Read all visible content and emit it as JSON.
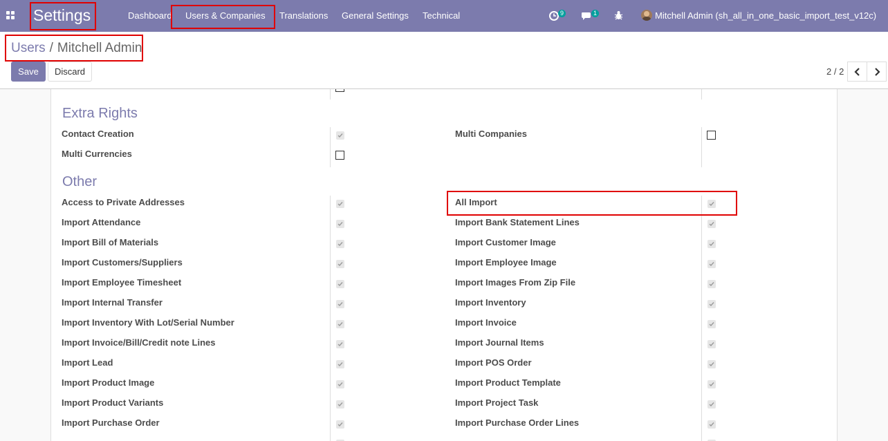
{
  "navbar": {
    "brand": "Settings",
    "menu": [
      {
        "label": "Dashboard"
      },
      {
        "label": "Users & Companies"
      },
      {
        "label": "Translations"
      },
      {
        "label": "General Settings"
      },
      {
        "label": "Technical"
      }
    ],
    "activity_count": "9",
    "message_count": "1",
    "user_name": "Mitchell Admin (sh_all_in_one_basic_import_test_v12c)"
  },
  "breadcrumb": {
    "parent": "Users",
    "separator": "/",
    "current": "Mitchell Admin"
  },
  "buttons": {
    "save": "Save",
    "discard": "Discard"
  },
  "pager": {
    "value": "2 / 2"
  },
  "form": {
    "extra_rights": {
      "title": "Extra Rights",
      "left": [
        {
          "label": "Contact Creation",
          "checked": true
        },
        {
          "label": "Multi Currencies",
          "checked": false
        }
      ],
      "right": [
        {
          "label": "Multi Companies",
          "checked": false
        }
      ]
    },
    "other": {
      "title": "Other",
      "left": [
        {
          "label": "Access to Private Addresses",
          "checked": true
        },
        {
          "label": "Import Attendance",
          "checked": true
        },
        {
          "label": "Import Bill of Materials",
          "checked": true
        },
        {
          "label": "Import Customers/Suppliers",
          "checked": true
        },
        {
          "label": "Import Employee Timesheet",
          "checked": true
        },
        {
          "label": "Import Internal Transfer",
          "checked": true
        },
        {
          "label": "Import Inventory With Lot/Serial Number",
          "checked": true
        },
        {
          "label": "Import Invoice/Bill/Credit note Lines",
          "checked": true
        },
        {
          "label": "Import Lead",
          "checked": true
        },
        {
          "label": "Import Product Image",
          "checked": true
        },
        {
          "label": "Import Product Variants",
          "checked": true
        },
        {
          "label": "Import Purchase Order",
          "checked": true
        }
      ],
      "right": [
        {
          "label": "All Import",
          "checked": true
        },
        {
          "label": "Import Bank Statement Lines",
          "checked": true
        },
        {
          "label": "Import Customer Image",
          "checked": true
        },
        {
          "label": "Import Employee Image",
          "checked": true
        },
        {
          "label": "Import Images From Zip File",
          "checked": true
        },
        {
          "label": "Import Inventory",
          "checked": true
        },
        {
          "label": "Import Invoice",
          "checked": true
        },
        {
          "label": "Import Journal Items",
          "checked": true
        },
        {
          "label": "Import POS Order",
          "checked": true
        },
        {
          "label": "Import Product Template",
          "checked": true
        },
        {
          "label": "Import Project Task",
          "checked": true
        },
        {
          "label": "Import Purchase Order Lines",
          "checked": true
        }
      ]
    }
  }
}
